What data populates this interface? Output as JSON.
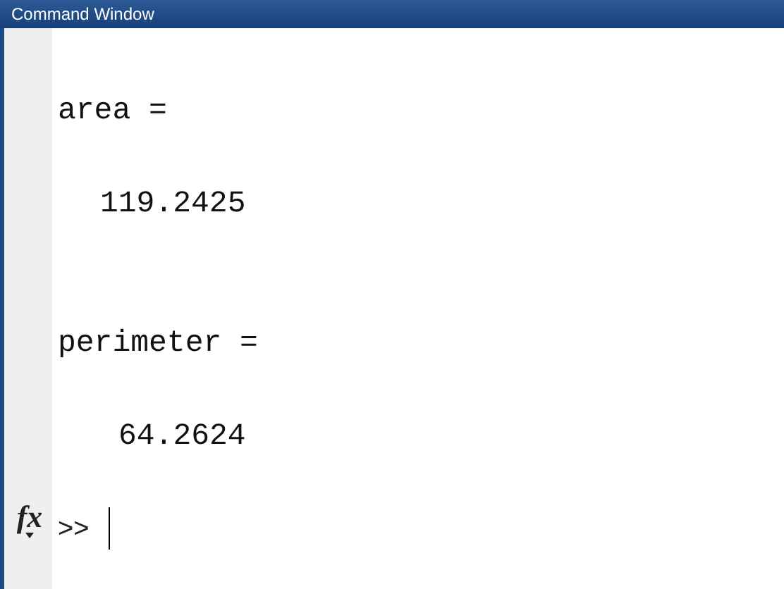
{
  "window": {
    "title": "Command Window"
  },
  "lines": [
    {
      "kind": "variable",
      "text": "area ="
    },
    {
      "kind": "value",
      "text": "119.2425"
    },
    {
      "kind": "variable",
      "text": "perimeter ="
    },
    {
      "kind": "value",
      "text": "64.2624"
    }
  ],
  "prompt": {
    "icon": "fx",
    "symbol": ">>"
  }
}
